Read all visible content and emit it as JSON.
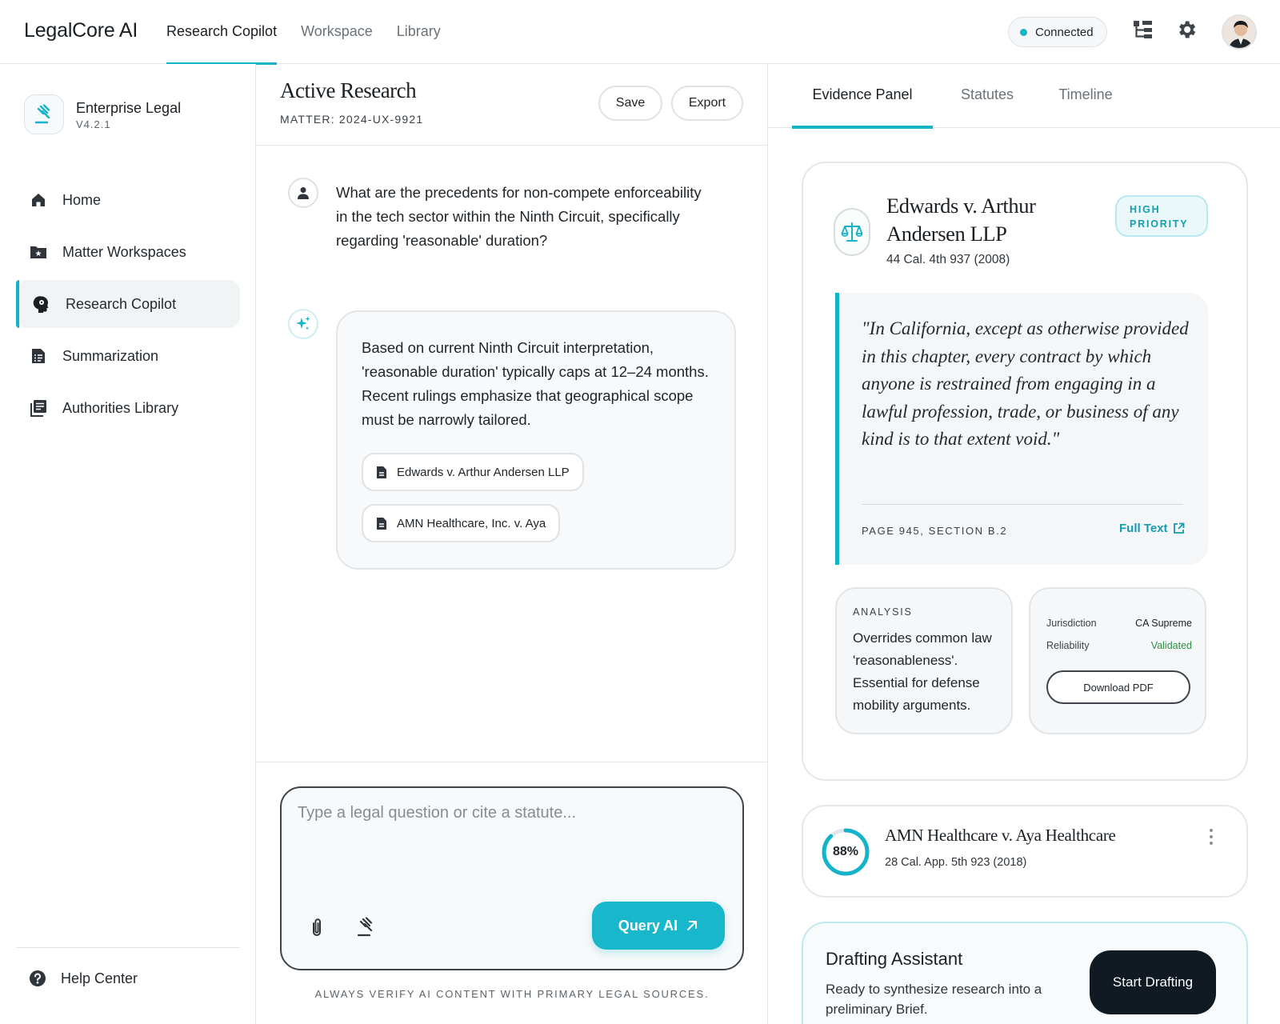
{
  "app": {
    "brand": "LegalCore AI",
    "nav": [
      {
        "label": "Research Copilot",
        "active": true
      },
      {
        "label": "Workspace",
        "active": false
      },
      {
        "label": "Library",
        "active": false
      }
    ],
    "status": "Connected",
    "accent": "#14b3c9"
  },
  "sidebar": {
    "org_name": "Enterprise Legal",
    "org_version": "V4.2.1",
    "items": [
      {
        "label": "Home",
        "icon": "home-icon"
      },
      {
        "label": "Matter Workspaces",
        "icon": "folder-star-icon"
      },
      {
        "label": "Research Copilot",
        "icon": "brain-head-icon",
        "active": true
      },
      {
        "label": "Summarization",
        "icon": "summary-doc-icon"
      },
      {
        "label": "Authorities Library",
        "icon": "library-books-icon"
      }
    ],
    "help": "Help Center"
  },
  "research": {
    "title": "Active Research",
    "matter": "MATTER: 2024-UX-9921",
    "save_label": "Save",
    "export_label": "Export",
    "user_message": "What are the precedents for non-compete enforceability in the tech sector within the Ninth Circuit, specifically regarding 'reasonable' duration?",
    "ai_message": "Based on current Ninth Circuit interpretation, 'reasonable duration' typically caps at 12–24 months. Recent rulings emphasize that geographical scope must be narrowly tailored.",
    "citations": [
      "Edwards v. Arthur Andersen LLP",
      "AMN Healthcare, Inc. v. Aya"
    ],
    "composer_placeholder": "Type a legal question or cite a statute...",
    "query_label": "Query AI",
    "disclaimer": "ALWAYS VERIFY AI CONTENT WITH PRIMARY LEGAL SOURCES."
  },
  "evidence": {
    "tabs": [
      "Evidence Panel",
      "Statutes",
      "Timeline"
    ],
    "main_case": {
      "title": "Edwards v. Arthur Andersen LLP",
      "citation": "44 Cal. 4th 937 (2008)",
      "badge": "HIGH PRIORITY",
      "quote": "\"In California, except as otherwise provided in this chapter, every contract by which anyone is restrained from engaging in a lawful profession, trade, or business of any kind is to that extent void.\"",
      "reference": "PAGE 945, SECTION B.2",
      "full_text_label": "Full Text",
      "analysis_label": "ANALYSIS",
      "analysis_text": "Overrides common law 'reasonableness'. Essential for defense mobility arguments.",
      "jurisdiction_label": "Jurisdiction",
      "jurisdiction_value": "CA Supreme",
      "reliability_label": "Reliability",
      "reliability_value": "Validated",
      "download_label": "Download PDF"
    },
    "second_case": {
      "title": "AMN Healthcare v. Aya Healthcare",
      "citation": "28 Cal. App. 5th 923 (2018)",
      "relevance_label": "88%",
      "relevance": 0.88
    },
    "drafting": {
      "title": "Drafting Assistant",
      "text": "Ready to synthesize research into a preliminary Brief.",
      "button": "Start Drafting"
    }
  }
}
